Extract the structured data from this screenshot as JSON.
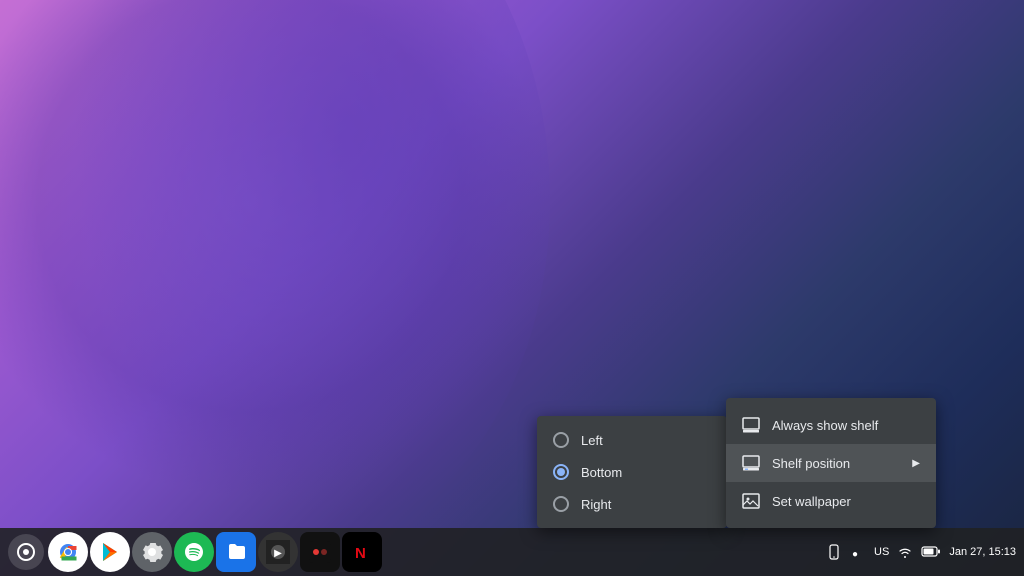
{
  "desktop": {
    "background": "chromeos-gradient"
  },
  "shelf": {
    "launcher_icon": "○",
    "apps": [
      {
        "name": "Chrome",
        "color": "#fff"
      },
      {
        "name": "Play Store",
        "color": "#fff"
      },
      {
        "name": "Settings",
        "color": "#5f6368"
      },
      {
        "name": "Spotify",
        "color": "#1DB954"
      },
      {
        "name": "Files",
        "color": "#1a73e8"
      },
      {
        "name": "App6",
        "color": "#333"
      },
      {
        "name": "App7",
        "color": "#333"
      },
      {
        "name": "App8",
        "color": "#c00"
      }
    ],
    "status": {
      "time": "Jan 27, 15:13",
      "network": "US"
    }
  },
  "submenu_shelf_position": {
    "items": [
      {
        "label": "Left",
        "selected": false
      },
      {
        "label": "Bottom",
        "selected": true
      },
      {
        "label": "Right",
        "selected": false
      }
    ]
  },
  "context_menu": {
    "items": [
      {
        "label": "Always show shelf",
        "icon": "monitor",
        "has_arrow": false
      },
      {
        "label": "Shelf position",
        "icon": "shelf",
        "has_arrow": true
      },
      {
        "label": "Set wallpaper",
        "icon": "wallpaper",
        "has_arrow": false
      }
    ]
  }
}
